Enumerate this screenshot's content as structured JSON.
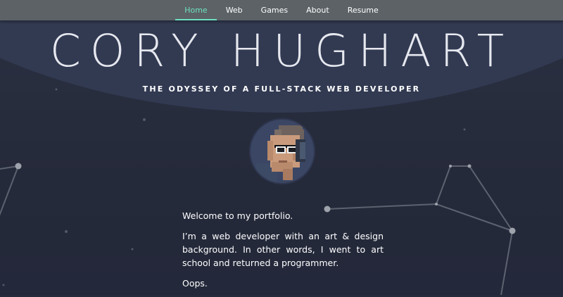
{
  "nav": {
    "items": [
      {
        "label": "Home",
        "active": true
      },
      {
        "label": "Web",
        "active": false
      },
      {
        "label": "Games",
        "active": false
      },
      {
        "label": "About",
        "active": false
      },
      {
        "label": "Resume",
        "active": false
      }
    ]
  },
  "hero": {
    "title": "CORY HUGHART",
    "subtitle": "THE ODYSSEY OF A FULL-STACK WEB DEVELOPER",
    "avatar_icon": "pixel-art-portrait-icon"
  },
  "intro": {
    "welcome": "Welcome to my portfolio.",
    "bio": "I’m a web developer with an art & design background. In other words, I went to art school and returned a programmer.",
    "oops": "Oops."
  },
  "colors": {
    "background": "#262b3b",
    "arc": "#323a52",
    "nav_bg": "#5c6266",
    "accent": "#6ee0c0",
    "text": "#ffffff",
    "constellation": "#6a6f7c"
  }
}
